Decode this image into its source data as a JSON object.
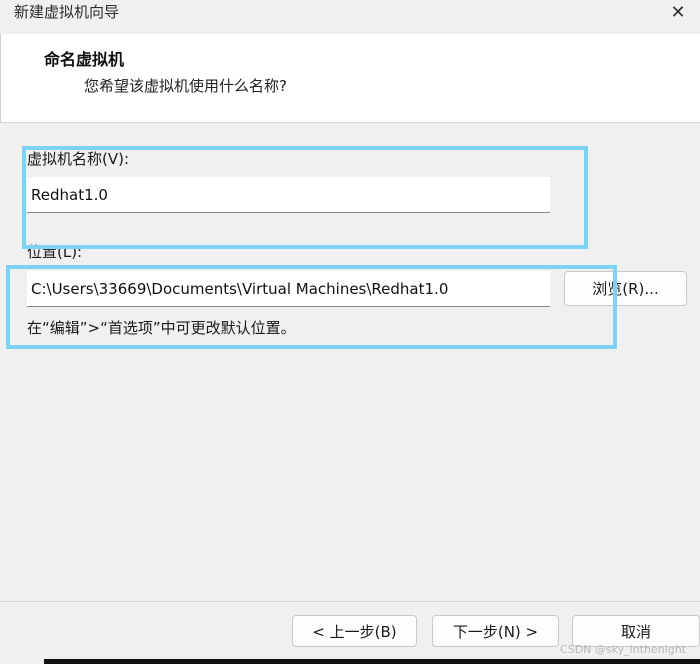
{
  "window": {
    "title": "新建虚拟机向导",
    "close_glyph": "✕"
  },
  "header": {
    "title": "命名虚拟机",
    "subtitle": "您希望该虚拟机使用什么名称?"
  },
  "form": {
    "name_label": "虚拟机名称(V):",
    "name_value": "Redhat1.0",
    "location_label": "位置(L):",
    "location_value": "C:\\Users\\33669\\Documents\\Virtual Machines\\Redhat1.0",
    "browse_label": "浏览(R)...",
    "hint": "在“编辑”>“首选项”中可更改默认位置。"
  },
  "footer": {
    "back_label": "< 上一步(B)",
    "next_label": "下一步(N) >",
    "cancel_label": "取消"
  },
  "watermark": "CSDN @sky_inthenight",
  "colors": {
    "highlight": "#7dd3f5"
  }
}
